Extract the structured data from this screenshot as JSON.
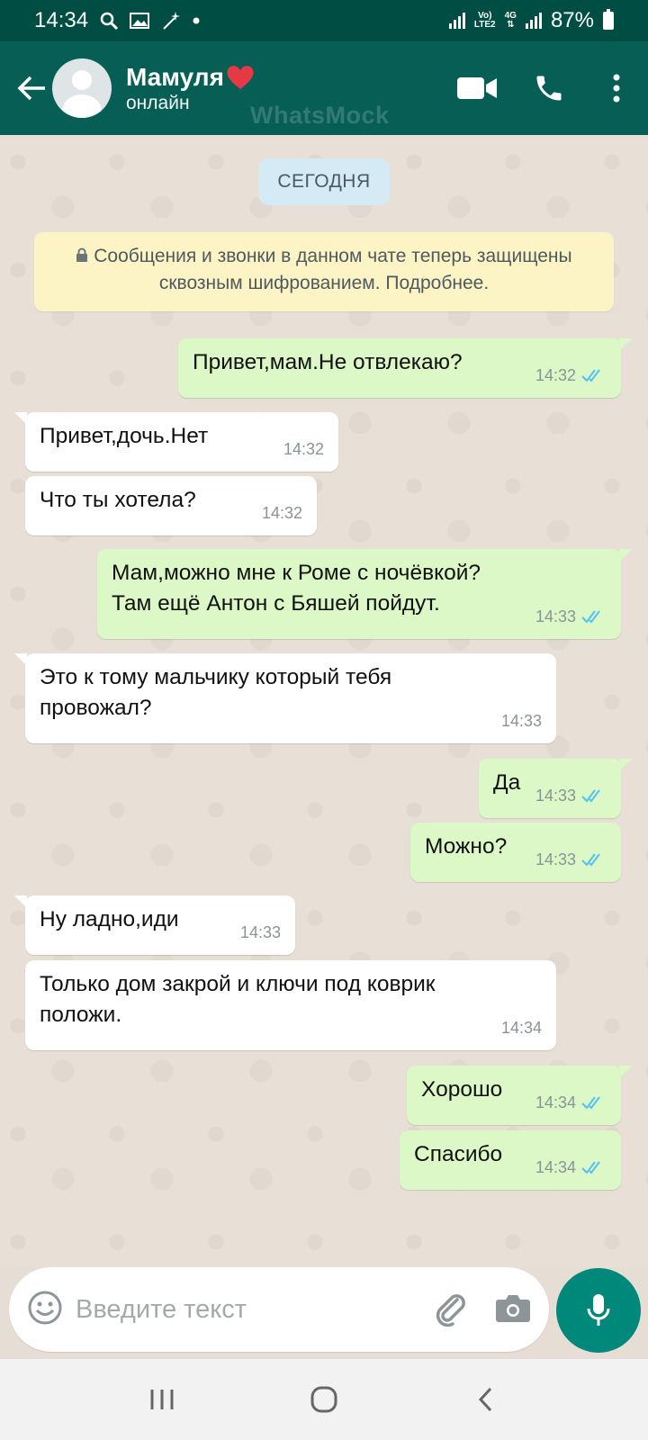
{
  "status_bar": {
    "time": "14:34",
    "network_top": "Vo)",
    "network_bottom": "LTE2",
    "network_type": "4G",
    "battery": "87%"
  },
  "header": {
    "contact_name": "Мамуля",
    "contact_emoji": "heart-icon",
    "status": "онлайн",
    "watermark": "WhatsMock",
    "colors": {
      "header": "#075e54",
      "status_bar": "#004d44"
    }
  },
  "chat": {
    "date_label": "СЕГОДНЯ",
    "encryption_notice": "Сообщения и звонки в данном чате теперь защищены сквозным шифрованием. Подробнее.",
    "messages": [
      {
        "dir": "out",
        "text": "Привет,мам.Не отвлекаю?",
        "time": "14:32"
      },
      {
        "dir": "in",
        "text": "Привет,дочь.Нет",
        "time": "14:32"
      },
      {
        "dir": "in",
        "text": "Что ты хотела?",
        "time": "14:32"
      },
      {
        "dir": "out",
        "text": "Мам,можно мне к Роме с ночёвкой?\nТам ещё Антон с Бяшей пойдут.",
        "time": "14:33"
      },
      {
        "dir": "in",
        "text": "Это к тому мальчику который тебя\nпровожал?",
        "time": "14:33"
      },
      {
        "dir": "out",
        "text": "Да",
        "time": "14:33"
      },
      {
        "dir": "out",
        "text": "Можно?",
        "time": "14:33"
      },
      {
        "dir": "in",
        "text": "Ну ладно,иди",
        "time": "14:33"
      },
      {
        "dir": "in",
        "text": "Только дом закрой и ключи под коврик\nположи.",
        "time": "14:34"
      },
      {
        "dir": "out",
        "text": "Хорошо",
        "time": "14:34"
      },
      {
        "dir": "out",
        "text": "Спасибо",
        "time": "14:34"
      }
    ]
  },
  "composer": {
    "placeholder": "Введите текст",
    "accent": "#00897b"
  }
}
